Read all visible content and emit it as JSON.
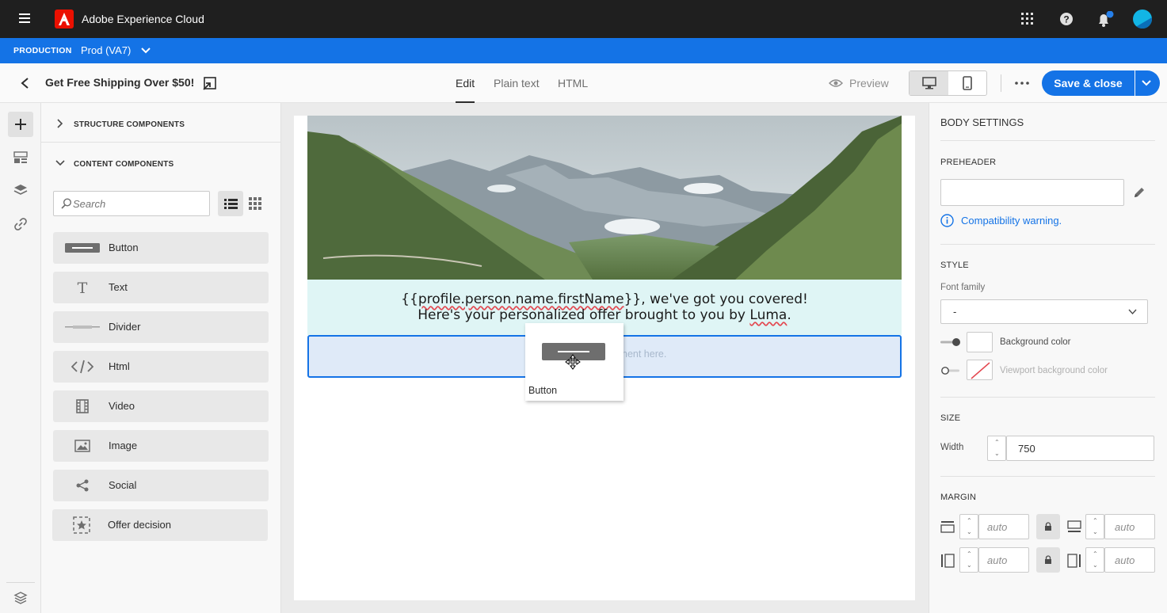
{
  "topbar": {
    "app_title": "Adobe Experience Cloud"
  },
  "orgbar": {
    "environment": "PRODUCTION",
    "sandbox": "Prod (VA7)"
  },
  "toolbar": {
    "page_title": "Get Free Shipping Over $50!",
    "tabs": [
      {
        "label": "Edit"
      },
      {
        "label": "Plain text"
      },
      {
        "label": "HTML"
      }
    ],
    "preview_label": "Preview",
    "save_label": "Save & close"
  },
  "left": {
    "structure_header": "STRUCTURE COMPONENTS",
    "content_header": "CONTENT COMPONENTS",
    "search_placeholder": "Search",
    "components": [
      {
        "label": "Button",
        "icon": "button-icon"
      },
      {
        "label": "Text",
        "icon": "text-icon"
      },
      {
        "label": "Divider",
        "icon": "divider-icon"
      },
      {
        "label": "Html",
        "icon": "code-icon"
      },
      {
        "label": "Video",
        "icon": "film-icon"
      },
      {
        "label": "Image",
        "icon": "image-icon"
      },
      {
        "label": "Social",
        "icon": "share-icon"
      },
      {
        "label": "Offer decision",
        "icon": "offer-decision-icon"
      }
    ]
  },
  "canvas": {
    "text_line1_pre": "{{",
    "text_line1_var": "profile.person.name.firstName",
    "text_line1_post": "}}, we've got you covered!",
    "text_line2_pre": "Here's your personalized offer brought to you by ",
    "text_line2_brand": "Luma",
    "text_line2_post": ".",
    "drop_hint": "nent here.",
    "drag_label": "Button"
  },
  "right": {
    "title": "BODY SETTINGS",
    "preheader_label": "PREHEADER",
    "preheader_value": "",
    "compat_warning": "Compatibility warning.",
    "style_label": "STYLE",
    "font_family_label": "Font family",
    "font_family_value": "-",
    "bg_color_label": "Background color",
    "viewport_bg_label": "Viewport background color",
    "size_label": "SIZE",
    "width_label": "Width",
    "width_value": "750",
    "margin_label": "MARGIN",
    "margin_top": "auto",
    "margin_bottom": "auto",
    "margin_left": "auto",
    "margin_right": "auto"
  },
  "colors": {
    "topbar": "#1f1f1f",
    "orgbar": "#1473e6",
    "accent": "#1473e6",
    "adobe_red": "#eb1000",
    "text_block_bg": "#dff5f5",
    "drop_zone_bg": "#dfeaf8"
  }
}
